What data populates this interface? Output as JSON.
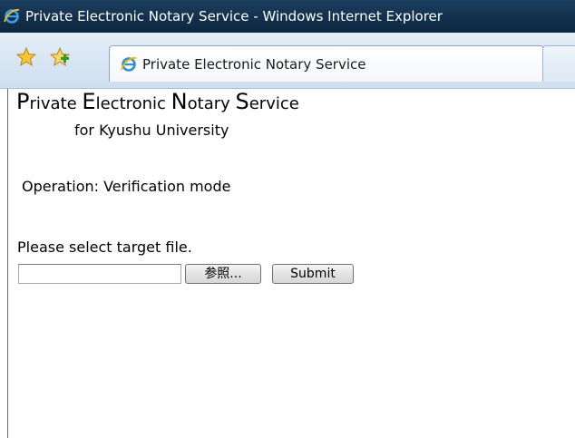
{
  "window": {
    "title": "Private Electronic Notary Service - Windows Internet Explorer",
    "icon": "internet-explorer-icon"
  },
  "toolbar": {
    "favorites_icon": "favorites-star-icon",
    "add_favorites_icon": "add-favorites-icon"
  },
  "tab": {
    "label": "Private Electronic Notary Service",
    "icon": "internet-explorer-icon"
  },
  "page": {
    "heading_parts": [
      {
        "cap": "P",
        "rest": "rivate "
      },
      {
        "cap": "E",
        "rest": "lectronic "
      },
      {
        "cap": "N",
        "rest": "otary "
      },
      {
        "cap": "S",
        "rest": "ervice"
      }
    ],
    "subheading": "for Kyushu University",
    "operation": "Operation: Verification mode",
    "instruction": "Please select target file.",
    "file_input_value": "",
    "browse_label": "参照...",
    "submit_label": "Submit"
  },
  "colors": {
    "titlebar": "#12304c",
    "tabbar": "#d6e4f2",
    "page_background": "#ffffff"
  }
}
